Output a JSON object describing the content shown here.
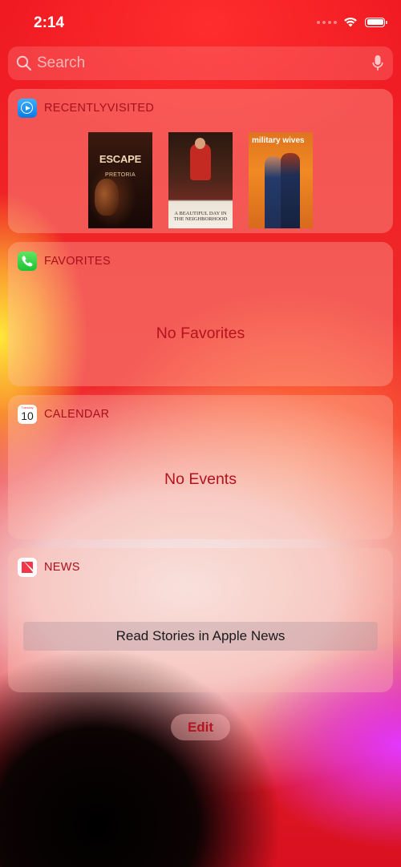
{
  "status_bar": {
    "time": "2:14",
    "battery_level": 1.0
  },
  "search": {
    "placeholder": "Search",
    "value": ""
  },
  "widgets": {
    "recently_visited": {
      "title": "RECENTLYVISITED",
      "icon": "play-circle-icon",
      "posters": [
        {
          "name": "escape-from-pretoria-poster",
          "text_main": "ESCAPE",
          "text_sub": "PRETORIA"
        },
        {
          "name": "beautiful-day-poster",
          "text_main": "A BEAUTIFUL DAY IN THE NEIGHBORHOOD"
        },
        {
          "name": "military-wives-poster",
          "text_main": "military wives"
        }
      ]
    },
    "favorites": {
      "title": "FAVORITES",
      "icon": "phone-icon",
      "message": "No Favorites"
    },
    "calendar": {
      "title": "CALENDAR",
      "icon": "calendar-icon",
      "icon_weekday": "Tuesday",
      "icon_day": "10",
      "message": "No Events"
    },
    "news": {
      "title": "NEWS",
      "icon": "news-icon",
      "button_label": "Read Stories in Apple News"
    }
  },
  "edit_label": "Edit",
  "colors": {
    "widget_title": "#a8101c",
    "message_text": "#b5121e",
    "edit_text": "#b81320"
  }
}
